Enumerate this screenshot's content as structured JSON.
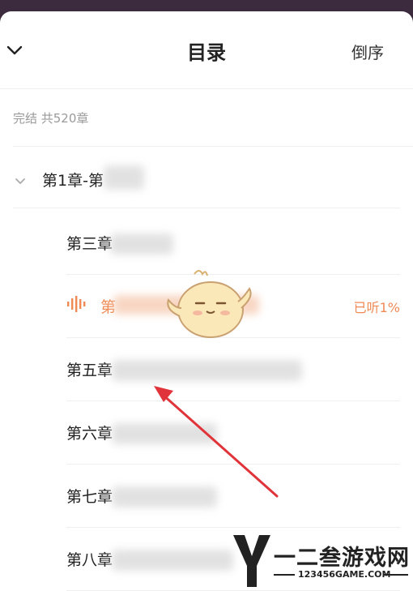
{
  "header": {
    "title": "目录",
    "reverse_label": "倒序"
  },
  "status": "完结 共520章",
  "volume": {
    "label": "第1章-第"
  },
  "chapters": [
    {
      "label": "第三章",
      "progress": ""
    },
    {
      "label": "第",
      "progress": "已听1%"
    },
    {
      "label": "第五章",
      "progress": ""
    },
    {
      "label": "第六章",
      "progress": ""
    },
    {
      "label": "第七章",
      "progress": ""
    },
    {
      "label": "第八章",
      "progress": ""
    }
  ],
  "colors": {
    "accent": "#f08a54",
    "annotation_arrow": "#e0333a"
  },
  "watermark": {
    "title": "一二叁游戏网",
    "url": "123456GAME.COM"
  }
}
